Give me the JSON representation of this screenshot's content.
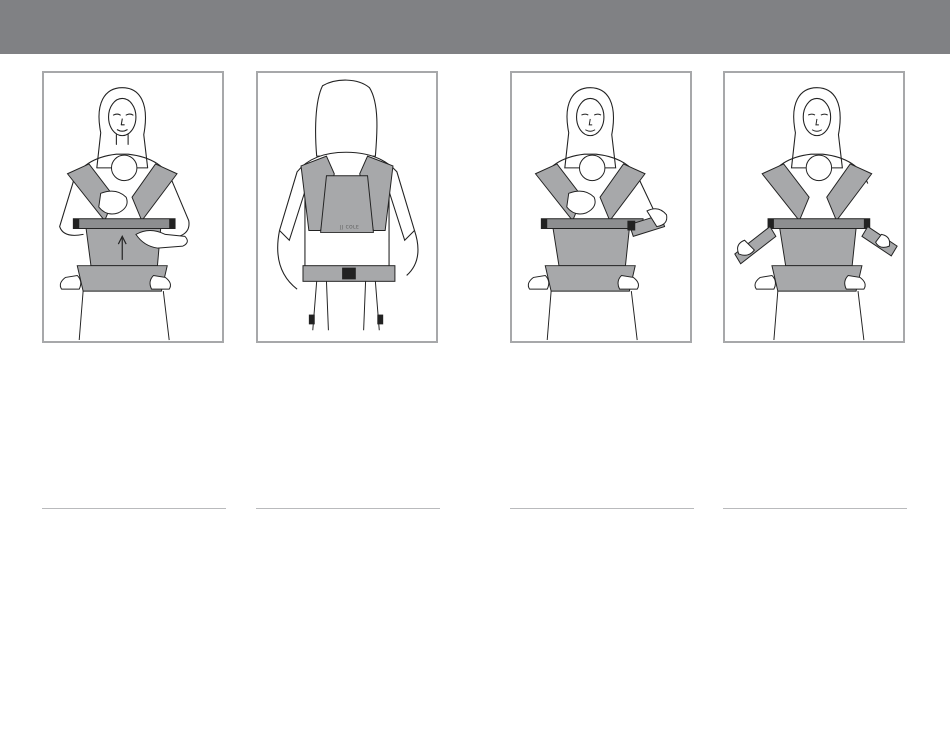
{
  "header": {
    "band_color": "#808184"
  },
  "steps": [
    {
      "illustration": "carrier-front-lift-baby-illustration"
    },
    {
      "illustration": "carrier-back-view-buckle-illustration",
      "brand_mark": "JJ COLE"
    },
    {
      "illustration": "carrier-front-fasten-side-buckle-illustration"
    },
    {
      "illustration": "carrier-front-tighten-straps-illustration"
    }
  ],
  "colors": {
    "carrier_fill": "#a7a8aa",
    "carrier_dark": "#8d8e90",
    "line": "#222222",
    "panel_border": "#a7a8aa",
    "rule": "#b9babc"
  }
}
